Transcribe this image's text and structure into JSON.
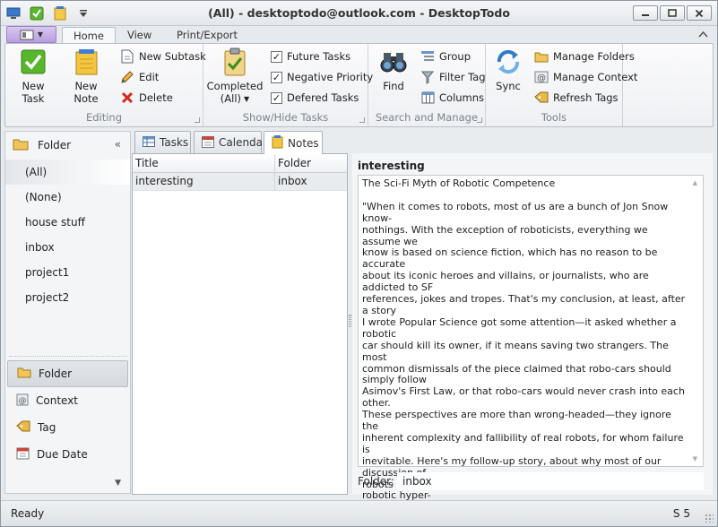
{
  "window": {
    "title": "(All) - desktoptodo@outlook.com - DesktopTodo"
  },
  "ribbon": {
    "tabs": [
      "Home",
      "View",
      "Print/Export"
    ],
    "groups": {
      "editing": {
        "label": "Editing",
        "new_task": "New Task",
        "new_note": "New Note",
        "new_subtask": "New Subtask",
        "edit": "Edit",
        "delete": "Delete"
      },
      "show_hide": {
        "label": "Show/Hide Tasks",
        "completed_line1": "Completed",
        "completed_line2": "(All)",
        "future_tasks": "Future Tasks",
        "negative_priority": "Negative Priority",
        "deferred_tasks": "Defered Tasks"
      },
      "search": {
        "label": "Search and Manage",
        "find": "Find",
        "group": "Group",
        "filter_tag": "Filter Tag",
        "columns": "Columns"
      },
      "tools": {
        "label": "Tools",
        "sync": "Sync",
        "manage_folders": "Manage Folders",
        "manage_context": "Manage Context",
        "refresh_tags": "Refresh Tags"
      }
    }
  },
  "nav": {
    "header": "Folder",
    "items": [
      "(All)",
      "(None)",
      "house stuff",
      "inbox",
      "project1",
      "project2"
    ],
    "bottom": [
      "Folder",
      "Context",
      "Tag",
      "Due Date"
    ]
  },
  "content_tabs": [
    "Tasks",
    "Calendar",
    "Notes"
  ],
  "grid": {
    "columns": [
      "Title",
      "Folder"
    ],
    "rows": [
      {
        "title": "interesting",
        "folder": "inbox"
      }
    ]
  },
  "detail": {
    "title": "interesting",
    "note_body": "The Sci-Fi Myth of Robotic Competence\n\n\"When it comes to robots, most of us are a bunch of Jon Snow know-\nnothings. With the exception of roboticists, everything we assume we\nknow is based on science fiction, which has no reason to be accurate\nabout its iconic heroes and villains, or journalists, who are addicted to SF\nreferences, jokes and tropes. That's my conclusion, at least, after a story\nI wrote Popular Science got some attention—it asked whether a robotic\ncar should kill its owner, if it means saving two strangers. The most\ncommon dismissals of the piece claimed that robo-cars should simply follow\nAsimov's First Law, or that robo-cars would never crash into each other.\nThese perspectives are more than wrong-headed—they ignore the\ninherent complexity and fallibility of real robots, for whom failure is\ninevitable. Here's my follow-up story, about why most of our discussion of\nrobots is based on make-believe, starting with the myth of robotic hyper-\ncompetence.\"",
    "folder_label": "Folder:",
    "folder_value": "inbox"
  },
  "status": {
    "left": "Ready",
    "right": "S 5"
  }
}
